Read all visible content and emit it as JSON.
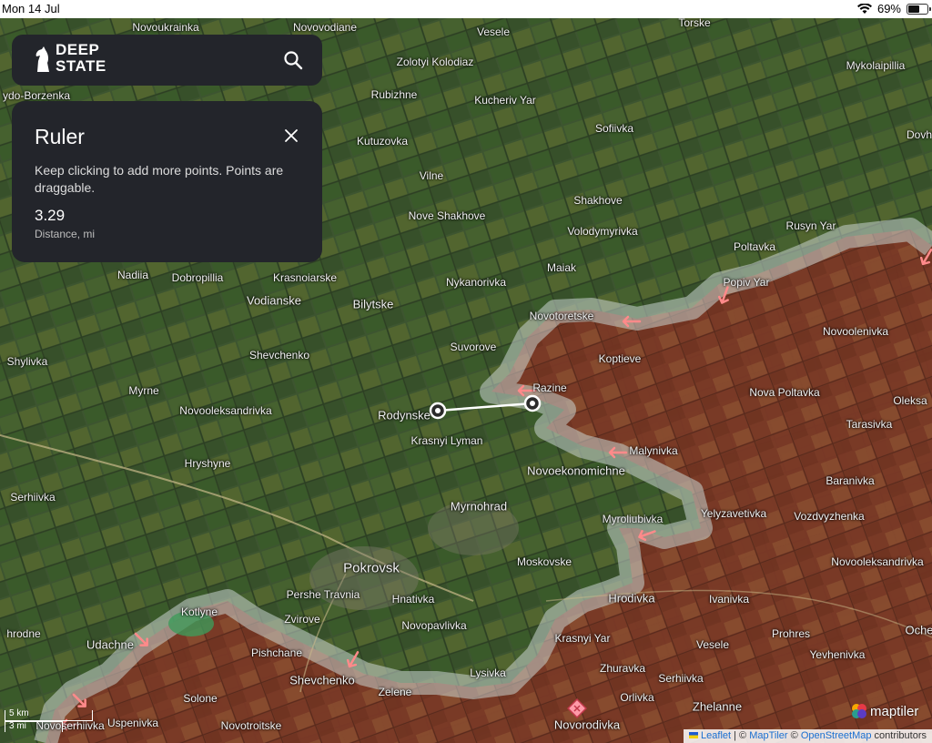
{
  "status_bar": {
    "time": "Mon 14 Jul",
    "battery": "69%",
    "battery_level": 0.69
  },
  "header": {
    "logo_line1": "DEEP",
    "logo_line2": "STATE",
    "search_icon": "search-icon"
  },
  "ruler": {
    "title": "Ruler",
    "description": "Keep clicking to add more points. Points are draggable.",
    "distance_value": "3.29",
    "distance_unit": "Distance, mi"
  },
  "scale": {
    "km": "5 km",
    "mi": "3 mi"
  },
  "attribution": {
    "leaflet": "Leaflet",
    "sep1": " | © ",
    "maptiler": "MapTiler",
    "sep2": " © ",
    "osm": "OpenStreetMap",
    "suffix": " contributors"
  },
  "maptiler_label": "maptiler",
  "colors": {
    "occupied": "#8a2e22",
    "grey_zone": "#c8d3cf",
    "arrow": "#ff8a8a",
    "panel": "#23252b"
  },
  "places": [
    {
      "name": "Novoukrainka",
      "size": "small"
    },
    {
      "name": "Novovodiane",
      "size": "small"
    },
    {
      "name": "Torske",
      "size": "small"
    },
    {
      "name": "Vesele",
      "size": "small"
    },
    {
      "name": "Zolotyi Kolodiaz",
      "size": "small"
    },
    {
      "name": "Mykolaipillia",
      "size": "small"
    },
    {
      "name": "ydo-Borzenka",
      "size": "small"
    },
    {
      "name": "Rubizhne",
      "size": "small"
    },
    {
      "name": "Kucheriv Yar",
      "size": "small"
    },
    {
      "name": "Sofiivka",
      "size": "small"
    },
    {
      "name": "Dovh",
      "size": "small"
    },
    {
      "name": "Kutuzovka",
      "size": "small"
    },
    {
      "name": "Vilne",
      "size": "small"
    },
    {
      "name": "Shakhove",
      "size": "small"
    },
    {
      "name": "Nove Shakhove",
      "size": "small"
    },
    {
      "name": "Volodymyrivka",
      "size": "small"
    },
    {
      "name": "Rusyn Yar",
      "size": "small"
    },
    {
      "name": "Poltavka",
      "size": "small"
    },
    {
      "name": "Maiak",
      "size": "small"
    },
    {
      "name": "Nadiia",
      "size": "small"
    },
    {
      "name": "Dobropillia",
      "size": "small"
    },
    {
      "name": "Krasnoiarske",
      "size": "small"
    },
    {
      "name": "Nykanorivka",
      "size": "small"
    },
    {
      "name": "Popiv Yar",
      "size": "small"
    },
    {
      "name": "Vodianske",
      "size": "mid"
    },
    {
      "name": "Bilytske",
      "size": "mid"
    },
    {
      "name": "Novotoretske",
      "size": "small"
    },
    {
      "name": "Novoolenivka",
      "size": "small"
    },
    {
      "name": "Shevchenko",
      "size": "small"
    },
    {
      "name": "Suvorove",
      "size": "small"
    },
    {
      "name": "Koptieve",
      "size": "small"
    },
    {
      "name": "Shylivka",
      "size": "small"
    },
    {
      "name": "Myrne",
      "size": "small"
    },
    {
      "name": "Razine",
      "size": "small"
    },
    {
      "name": "Nova Poltavka",
      "size": "small"
    },
    {
      "name": "Oleksa",
      "size": "small"
    },
    {
      "name": "Novooleksandrivka",
      "size": "small"
    },
    {
      "name": "Rodynske",
      "size": "mid"
    },
    {
      "name": "Tarasivka",
      "size": "small"
    },
    {
      "name": "Krasnyi Lyman",
      "size": "small"
    },
    {
      "name": "Malynivka",
      "size": "small"
    },
    {
      "name": "Hryshyne",
      "size": "small"
    },
    {
      "name": "Novoekonomichne",
      "size": "mid"
    },
    {
      "name": "Baranivka",
      "size": "small"
    },
    {
      "name": "Serhiivka",
      "size": "small"
    },
    {
      "name": "Myrnohrad",
      "size": "mid"
    },
    {
      "name": "Yelyzavetivka",
      "size": "small"
    },
    {
      "name": "Vozdvyzhenka",
      "size": "small"
    },
    {
      "name": "Myroliubivka",
      "size": "small"
    },
    {
      "name": "Moskovske",
      "size": "small"
    },
    {
      "name": "Novooleksandrivka",
      "size": "small"
    },
    {
      "name": "Pokrovsk",
      "size": "big"
    },
    {
      "name": "Pershe Travnia",
      "size": "small"
    },
    {
      "name": "Hnativka",
      "size": "small"
    },
    {
      "name": "Hrodivka",
      "size": "mid"
    },
    {
      "name": "Ivanivka",
      "size": "small"
    },
    {
      "name": "Kotlyne",
      "size": "small"
    },
    {
      "name": "Zvirove",
      "size": "small"
    },
    {
      "name": "Novopavlivka",
      "size": "small"
    },
    {
      "name": "Krasnyi Yar",
      "size": "small"
    },
    {
      "name": "Prohres",
      "size": "small"
    },
    {
      "name": "Oche",
      "size": "mid"
    },
    {
      "name": "hrodne",
      "size": "small"
    },
    {
      "name": "Udachne",
      "size": "mid"
    },
    {
      "name": "Pishchane",
      "size": "small"
    },
    {
      "name": "Vesele",
      "size": "small"
    },
    {
      "name": "Yevhenivka",
      "size": "small"
    },
    {
      "name": "Shevchenko",
      "size": "mid"
    },
    {
      "name": "Lysivka",
      "size": "small"
    },
    {
      "name": "Zhuravka",
      "size": "small"
    },
    {
      "name": "Serhiivka",
      "size": "small"
    },
    {
      "name": "Solone",
      "size": "small"
    },
    {
      "name": "Zelene",
      "size": "small"
    },
    {
      "name": "Orlivka",
      "size": "small"
    },
    {
      "name": "Zhelanne",
      "size": "mid"
    },
    {
      "name": "Uspenivka",
      "size": "small"
    },
    {
      "name": "Novotroitske",
      "size": "small"
    },
    {
      "name": "Novorodivka",
      "size": "mid"
    },
    {
      "name": "Novoserhiivka",
      "size": "small"
    }
  ]
}
